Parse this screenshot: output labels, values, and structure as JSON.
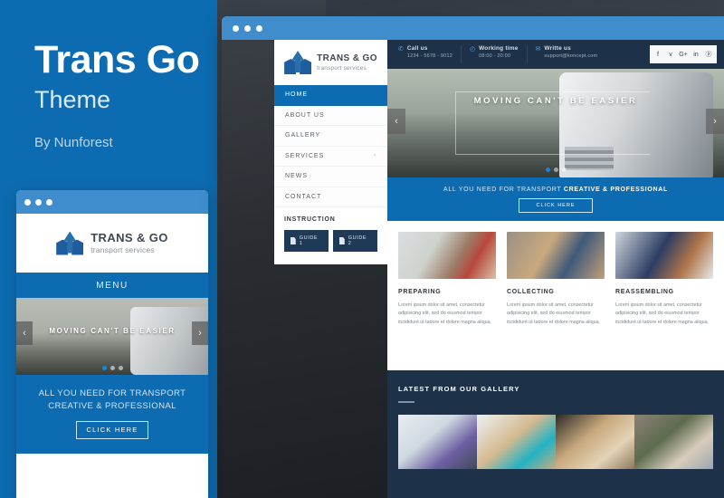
{
  "hero": {
    "title": "Trans Go",
    "subtitle": "Theme",
    "author": "By Nunforest"
  },
  "brand": {
    "name": "TRANS & GO",
    "tagline": "transport services",
    "accent": "#0d6cb1",
    "dark": "#1d3149",
    "bar": "#3f8dcc"
  },
  "mobile": {
    "menu_label": "MENU",
    "slider": {
      "caption": "MOVING CAN'T BE EASIER",
      "prev": "‹",
      "next": "›",
      "dots": 3,
      "active_dot": 1
    },
    "cta": {
      "line1": "ALL YOU NEED FOR TRANSPORT",
      "line2": "CREATIVE & PROFESSIONAL",
      "button": "CLICK HERE"
    }
  },
  "desktop": {
    "topbar": [
      {
        "icon": "phone-icon",
        "glyph": "✆",
        "label": "Call us",
        "value": "1234 - 5678 - 9012"
      },
      {
        "icon": "clock-icon",
        "glyph": "◴",
        "label": "Working time",
        "value": "08:00 - 20:00"
      },
      {
        "icon": "mail-icon",
        "glyph": "✉",
        "label": "Writte us",
        "value": "support@koncept.com"
      }
    ],
    "social": [
      {
        "name": "facebook-icon",
        "glyph": "f"
      },
      {
        "name": "twitter-icon",
        "glyph": "ᴠ"
      },
      {
        "name": "google-plus-icon",
        "glyph": "G+"
      },
      {
        "name": "linkedin-icon",
        "glyph": "in"
      },
      {
        "name": "pinterest-icon",
        "glyph": "ⓟ"
      }
    ],
    "nav": [
      {
        "label": "HOME",
        "active": true,
        "caret": ""
      },
      {
        "label": "ABOUT US",
        "active": false,
        "caret": ""
      },
      {
        "label": "GALLERY",
        "active": false,
        "caret": ""
      },
      {
        "label": "SERVICES",
        "active": false,
        "caret": "›"
      },
      {
        "label": "NEWS",
        "active": false,
        "caret": ""
      },
      {
        "label": "CONTACT",
        "active": false,
        "caret": ""
      }
    ],
    "instruction": {
      "title": "INSTRUCTION",
      "buttons": [
        {
          "label": "GUIDE 1",
          "icon": "pdf-file-icon"
        },
        {
          "label": "GUIDE 2",
          "icon": "pdf-file-icon"
        }
      ]
    },
    "slider": {
      "caption": "MOVING CAN'T BE EASIER",
      "prev": "‹",
      "next": "›",
      "dots": 3,
      "active_dot": 1
    },
    "cta": {
      "prefix": "ALL YOU NEED FOR TRANSPORT ",
      "strong": "CREATIVE & PROFESSIONAL",
      "button": "CLICK HERE"
    },
    "services": [
      {
        "title": "PREPARING",
        "text": "Lorem ipsum dolor sit amet, consectetur adipisicing elit, sed do eiusmod tempor incididunt ut labore et dolore magna aliqua."
      },
      {
        "title": "COLLECTING",
        "text": "Lorem ipsum dolor sit amet, consectetur adipisicing elit, sed do eiusmod tempor incididunt ut labore et dolore magna aliqua."
      },
      {
        "title": "REASSEMBLING",
        "text": "Lorem ipsum dolor sit amet, consectetur adipisicing elit, sed do eiusmod tempor incididunt ut labore et dolore magna aliqua."
      }
    ],
    "gallery": {
      "title": "LATEST FROM OUR GALLERY",
      "items": [
        {
          "name": "gallery-image-1"
        },
        {
          "name": "gallery-image-2"
        },
        {
          "name": "gallery-image-3"
        },
        {
          "name": "gallery-image-4"
        }
      ]
    }
  }
}
